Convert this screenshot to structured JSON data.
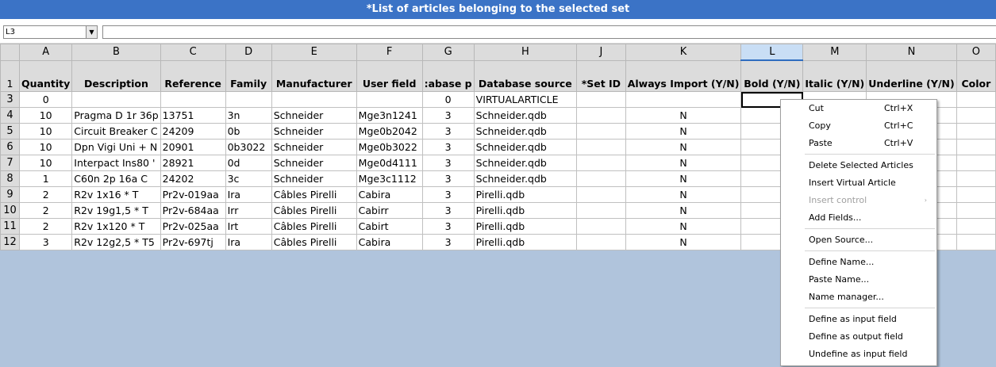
{
  "window": {
    "title": "*List of articles belonging to the selected set"
  },
  "formula_bar": {
    "name_box_value": "L3",
    "formula_value": ""
  },
  "grid": {
    "column_letters": [
      "A",
      "B",
      "C",
      "D",
      "E",
      "F",
      "G",
      "H",
      "J",
      "K",
      "L",
      "M",
      "N",
      "O"
    ],
    "selected_column": "L",
    "header_row_number": "1",
    "field_headers": [
      "Quantity",
      "Description",
      "Reference",
      "Family",
      "Manufacturer",
      "User field",
      ":abase p",
      "Database source",
      "*Set ID",
      "Always Import (Y/N)",
      "Bold (Y/N)",
      "Italic (Y/N)",
      "Underline (Y/N)",
      "Color"
    ],
    "rows": [
      {
        "row": "3",
        "cells": [
          "0",
          "",
          "",
          "",
          "",
          "",
          "0",
          "VIRTUALARTICLE",
          "",
          "",
          "",
          "",
          "",
          ""
        ]
      },
      {
        "row": "4",
        "cells": [
          "10",
          "Pragma D 1r 36p",
          "13751",
          "3n",
          "Schneider",
          "Mge3n1241",
          "3",
          "Schneider.qdb",
          "",
          "N",
          "",
          "",
          "",
          ""
        ]
      },
      {
        "row": "5",
        "cells": [
          "10",
          "Circuit Breaker C",
          "24209",
          "0b",
          "Schneider",
          "Mge0b2042",
          "3",
          "Schneider.qdb",
          "",
          "N",
          "",
          "",
          "",
          ""
        ]
      },
      {
        "row": "6",
        "cells": [
          "10",
          "Dpn Vigi Uni + N",
          "20901",
          "0b3022",
          "Schneider",
          "Mge0b3022",
          "3",
          "Schneider.qdb",
          "",
          "N",
          "",
          "",
          "",
          ""
        ]
      },
      {
        "row": "7",
        "cells": [
          "10",
          "Interpact Ins80 '",
          "28921",
          "0d",
          "Schneider",
          "Mge0d4111",
          "3",
          "Schneider.qdb",
          "",
          "N",
          "",
          "",
          "",
          ""
        ]
      },
      {
        "row": "8",
        "cells": [
          "1",
          "C60n 2p 16a  C",
          "24202",
          "3c",
          "Schneider",
          "Mge3c1112",
          "3",
          "Schneider.qdb",
          "",
          "N",
          "",
          "",
          "",
          ""
        ]
      },
      {
        "row": "9",
        "cells": [
          "2",
          "R2v 1x16 * T",
          "Pr2v-019aa",
          "Ira",
          "Câbles Pirelli",
          "Cabira",
          "3",
          "Pirelli.qdb",
          "",
          "N",
          "",
          "",
          "",
          ""
        ]
      },
      {
        "row": "10",
        "cells": [
          "2",
          "R2v 19g1,5 * T",
          "Pr2v-684aa",
          "Irr",
          "Câbles Pirelli",
          "Cabirr",
          "3",
          "Pirelli.qdb",
          "",
          "N",
          "",
          "",
          "",
          ""
        ]
      },
      {
        "row": "11",
        "cells": [
          "2",
          "R2v 1x120 * T",
          "Pr2v-025aa",
          "Irt",
          "Câbles Pirelli",
          "Cabirt",
          "3",
          "Pirelli.qdb",
          "",
          "N",
          "",
          "",
          "",
          ""
        ]
      },
      {
        "row": "12",
        "cells": [
          "3",
          "R2v 12g2,5 * T5",
          "Pr2v-697tj",
          "Ira",
          "Câbles Pirelli",
          "Cabira",
          "3",
          "Pirelli.qdb",
          "",
          "N",
          "",
          "",
          "",
          ""
        ]
      }
    ]
  },
  "context_menu": {
    "items": [
      {
        "label": "Cut",
        "shortcut": "Ctrl+X",
        "enabled": true
      },
      {
        "label": "Copy",
        "shortcut": "Ctrl+C",
        "enabled": true
      },
      {
        "label": "Paste",
        "shortcut": "Ctrl+V",
        "enabled": true
      },
      {
        "label": "Delete Selected Articles",
        "shortcut": "",
        "enabled": true
      },
      {
        "label": "Insert Virtual Article",
        "shortcut": "",
        "enabled": true
      },
      {
        "label": "Insert control",
        "shortcut": "",
        "enabled": false
      },
      {
        "label": "Add Fields...",
        "shortcut": "",
        "enabled": true
      },
      {
        "label": "Open Source...",
        "shortcut": "",
        "enabled": true
      },
      {
        "label": "Define Name...",
        "shortcut": "",
        "enabled": true
      },
      {
        "label": "Paste Name...",
        "shortcut": "",
        "enabled": true
      },
      {
        "label": "Name manager...",
        "shortcut": "",
        "enabled": true
      },
      {
        "label": "Define as input field",
        "shortcut": "",
        "enabled": true
      },
      {
        "label": "Define as output field",
        "shortcut": "",
        "enabled": true
      },
      {
        "label": "Undefine as input field",
        "shortcut": "",
        "enabled": true
      }
    ],
    "submenu_arrow": "›",
    "submenu_icon": "chevron-right-icon"
  },
  "colors": {
    "title_bar": "#3b73c6",
    "sheet_background": "#b0c4dc",
    "header_gray": "#dcdcdc"
  }
}
